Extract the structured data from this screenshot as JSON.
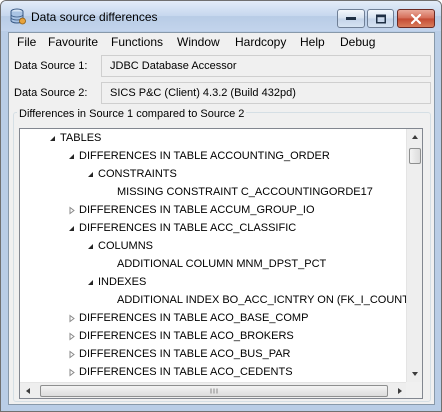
{
  "window": {
    "title": "Data source differences"
  },
  "menu": [
    {
      "label": "File"
    },
    {
      "label": "Favourite"
    },
    {
      "label": "Functions"
    },
    {
      "label": "Window"
    },
    {
      "label": "Hardcopy"
    },
    {
      "label": "Help"
    },
    {
      "label": "Debug"
    }
  ],
  "source1": {
    "label": "Data Source 1:",
    "value": "JDBC Database Accessor"
  },
  "source2": {
    "label": "Data Source 2:",
    "value": "SICS P&C (Client) 4.3.2  (Build 432pd)"
  },
  "differences": {
    "group_label": "Differences in Source 1 compared to Source 2",
    "tree": [
      {
        "text": "TABLES",
        "expander": "expanded"
      },
      {
        "text": "DIFFERENCES IN TABLE ACCOUNTING_ORDER",
        "expander": "expanded"
      },
      {
        "text": "CONSTRAINTS",
        "expander": "expanded"
      },
      {
        "text": "MISSING CONSTRAINT C_ACCOUNTINGORDE17",
        "expander": "none"
      },
      {
        "text": "DIFFERENCES IN TABLE ACCUM_GROUP_IO",
        "expander": "collapsed"
      },
      {
        "text": "DIFFERENCES IN TABLE ACC_CLASSIFIC",
        "expander": "expanded"
      },
      {
        "text": "COLUMNS",
        "expander": "expanded"
      },
      {
        "text": "ADDITIONAL COLUMN MNM_DPST_PCT",
        "expander": "none"
      },
      {
        "text": "INDEXES",
        "expander": "expanded"
      },
      {
        "text": "ADDITIONAL INDEX BO_ACC_ICNTRY ON (FK_I_COUNTRY",
        "expander": "none"
      },
      {
        "text": "DIFFERENCES IN TABLE ACO_BASE_COMP",
        "expander": "collapsed"
      },
      {
        "text": "DIFFERENCES IN TABLE ACO_BROKERS",
        "expander": "collapsed"
      },
      {
        "text": "DIFFERENCES IN TABLE ACO_BUS_PAR",
        "expander": "collapsed"
      },
      {
        "text": "DIFFERENCES IN TABLE ACO_CEDENTS",
        "expander": "collapsed"
      }
    ]
  }
}
